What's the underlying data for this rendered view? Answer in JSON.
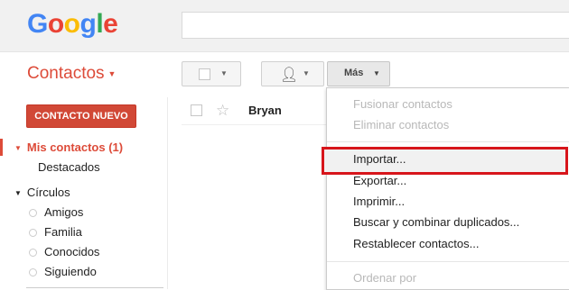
{
  "header": {
    "logo_letters": [
      "G",
      "o",
      "o",
      "g",
      "l",
      "e"
    ],
    "logo_colors": [
      "#4285f4",
      "#ea4335",
      "#fbbc05",
      "#4285f4",
      "#34a853",
      "#ea4335"
    ],
    "search_value": ""
  },
  "app": {
    "title": "Contactos"
  },
  "toolbar": {
    "more_label": "Más"
  },
  "sidebar": {
    "new_contact": "CONTACTO NUEVO",
    "my_contacts": "Mis contactos (1)",
    "starred": "Destacados",
    "circles_label": "Círculos",
    "circles": [
      "Amigos",
      "Familia",
      "Conocidos",
      "Siguiendo"
    ]
  },
  "contacts": [
    {
      "name": "Bryan"
    }
  ],
  "more_menu": {
    "merge": "Fusionar contactos",
    "delete": "Eliminar contactos",
    "import": "Importar...",
    "export": "Exportar...",
    "print": "Imprimir...",
    "find_duplicates": "Buscar y combinar duplicados...",
    "restore": "Restablecer contactos...",
    "sort_by": "Ordenar por"
  },
  "colors": {
    "accent": "#dd4b39",
    "highlight_box": "#d7151b"
  }
}
